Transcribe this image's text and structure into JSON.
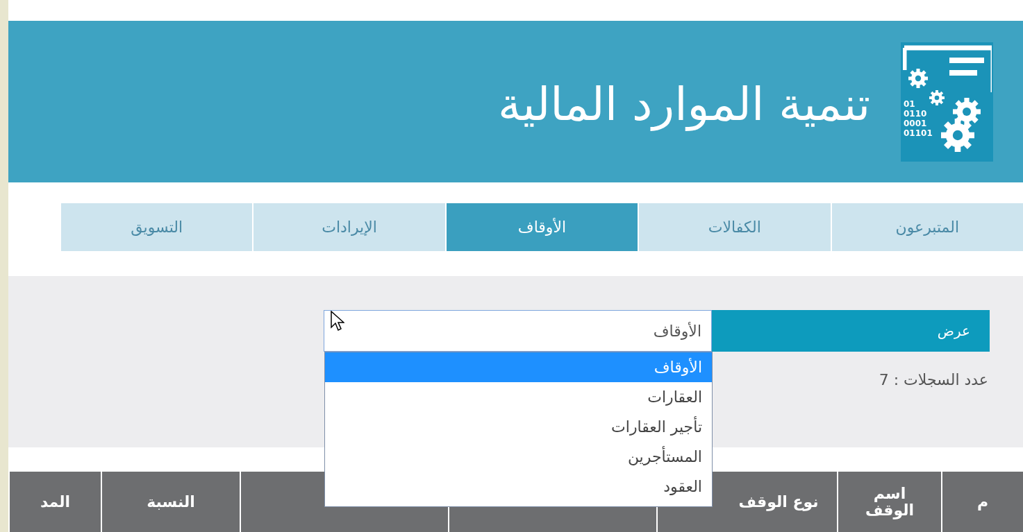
{
  "header": {
    "title": "تنمية الموارد المالية",
    "logo_lines": [
      "01",
      "0110",
      "0001",
      "01101"
    ]
  },
  "tabs": [
    {
      "label": "المتبرعون",
      "selected": false
    },
    {
      "label": "الكفالات",
      "selected": false
    },
    {
      "label": "الأوقاف",
      "selected": true
    },
    {
      "label": "الإيرادات",
      "selected": false
    },
    {
      "label": "التسويق",
      "selected": false
    }
  ],
  "filter": {
    "label": "عرض",
    "select": {
      "value": "الأوقاف",
      "expanded": true,
      "options": [
        {
          "label": "الأوقاف",
          "selected": true
        },
        {
          "label": "العقارات",
          "selected": false
        },
        {
          "label": "تأجير العقارات",
          "selected": false
        },
        {
          "label": "المستأجرين",
          "selected": false
        },
        {
          "label": "العقود",
          "selected": false
        }
      ]
    }
  },
  "record_count": "عدد السجلات : 7",
  "table": {
    "columns": [
      {
        "label": "م"
      },
      {
        "label": "اسم الوقف"
      },
      {
        "label": "نوع الوقف"
      },
      {},
      {},
      {
        "label": "النسبة"
      },
      {
        "label": "المد"
      }
    ]
  }
}
